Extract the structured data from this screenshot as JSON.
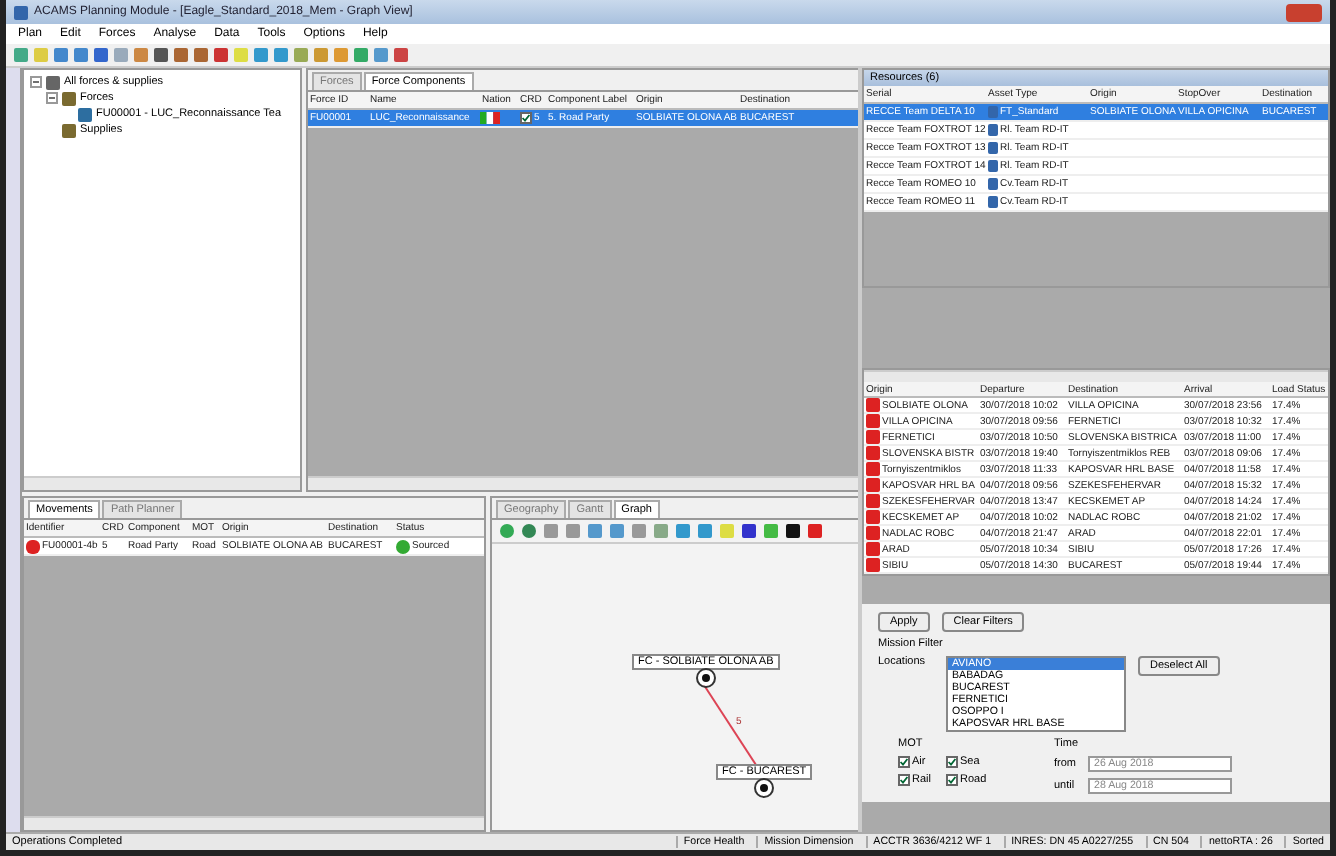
{
  "window": {
    "title": "ACAMS Planning Module - [Eagle_Standard_2018_Mem - Graph View]"
  },
  "menu": [
    "Plan",
    "Edit",
    "Forces",
    "Analyse",
    "Data",
    "Tools",
    "Options",
    "Help"
  ],
  "tree": {
    "label": "All forces & supplies",
    "expanded": true,
    "children": [
      {
        "label": "Forces",
        "expanded": true,
        "children": [
          {
            "label": "FU00001 - LUC_Reconnaissance Tea"
          }
        ]
      },
      {
        "label": "Supplies"
      }
    ]
  },
  "top_tabs": [
    {
      "label": "Forces",
      "selected": false
    },
    {
      "label": "Force Components",
      "selected": true
    }
  ],
  "force_table": {
    "columns": [
      "Force ID",
      "Name",
      "Nation",
      "CRD",
      "Component Label",
      "Origin",
      "Destination"
    ],
    "rows": [
      {
        "selected": true,
        "cells": [
          "FU00001",
          "LUC_Reconnaissance",
          "",
          "5",
          "5. Road Party",
          "SOLBIATE OLONA AB",
          "BUCAREST"
        ]
      }
    ]
  },
  "bottom_tabs": [
    {
      "label": "Movements",
      "selected": true
    },
    {
      "label": "Path Planner",
      "selected": false
    }
  ],
  "movements": {
    "columns": [
      "Identifier",
      "CRD",
      "Component",
      "MOT",
      "Origin",
      "Destination",
      "Status"
    ],
    "rows": [
      {
        "selected": false,
        "cells": [
          "FU00001-4b",
          "5",
          "Road Party",
          "Road",
          "SOLBIATE OLONA AB",
          "BUCAREST",
          "Sourced"
        ]
      }
    ]
  },
  "graph_tabs": [
    {
      "label": "Geography",
      "selected": false
    },
    {
      "label": "Gantt",
      "selected": false
    },
    {
      "label": "Graph",
      "selected": true
    }
  ],
  "graph": {
    "nodes": [
      "FC - SOLBIATE OLONA AB",
      "FC - BUCAREST"
    ],
    "edge_label": "5"
  },
  "resources": {
    "title": "Resources (6)",
    "columns": [
      "Serial",
      "Asset Type",
      "Origin",
      "StopOver",
      "Destination"
    ],
    "rows": [
      {
        "selected": true,
        "cells": [
          "RECCE Team DELTA 10",
          "FT_Standard",
          "SOLBIATE OLONA",
          "VILLA OPICINA",
          "BUCAREST"
        ]
      },
      {
        "selected": false,
        "cells": [
          "Recce Team FOXTROT 12",
          "Rl. Team RD-IT",
          "",
          "",
          ""
        ]
      },
      {
        "selected": false,
        "cells": [
          "Recce Team FOXTROT 13",
          "Rl. Team RD-IT",
          "",
          "",
          ""
        ]
      },
      {
        "selected": false,
        "cells": [
          "Recce Team FOXTROT 14",
          "Rl. Team RD-IT",
          "",
          "",
          ""
        ]
      },
      {
        "selected": false,
        "cells": [
          "Recce Team ROMEO 10",
          "Cv.Team RD-IT",
          "",
          "",
          ""
        ]
      },
      {
        "selected": false,
        "cells": [
          "Recce Team ROMEO 11",
          "Cv.Team RD-IT",
          "",
          "",
          ""
        ]
      }
    ]
  },
  "legs": {
    "columns": [
      "Origin",
      "Departure",
      "Destination",
      "Arrival",
      "Load Status"
    ],
    "rows": [
      [
        "SOLBIATE OLONA",
        "30/07/2018 10:02",
        "VILLA OPICINA",
        "30/07/2018 23:56",
        "17.4%"
      ],
      [
        "VILLA OPICINA",
        "30/07/2018 09:56",
        "FERNETICI",
        "03/07/2018 10:32",
        "17.4%"
      ],
      [
        "FERNETICI",
        "03/07/2018 10:50",
        "SLOVENSKA BISTRICA",
        "03/07/2018 11:00",
        "17.4%"
      ],
      [
        "SLOVENSKA BISTR",
        "03/07/2018 19:40",
        "Tornyiszentmiklos REB",
        "03/07/2018 09:06",
        "17.4%"
      ],
      [
        "Tornyiszentmiklos",
        "03/07/2018 11:33",
        "KAPOSVAR HRL BASE",
        "04/07/2018 11:58",
        "17.4%"
      ],
      [
        "KAPOSVAR HRL BA",
        "04/07/2018 09:56",
        "SZEKESFEHERVAR",
        "04/07/2018 15:32",
        "17.4%"
      ],
      [
        "SZEKESFEHERVAR",
        "04/07/2018 13:47",
        "KECSKEMET AP",
        "04/07/2018 14:24",
        "17.4%"
      ],
      [
        "KECSKEMET AP",
        "04/07/2018 10:02",
        "NADLAC ROBC",
        "04/07/2018 21:02",
        "17.4%"
      ],
      [
        "NADLAC ROBC",
        "04/07/2018 21:47",
        "ARAD",
        "04/07/2018 22:01",
        "17.4%"
      ],
      [
        "ARAD",
        "05/07/2018 10:34",
        "SIBIU",
        "05/07/2018 17:26",
        "17.4%"
      ],
      [
        "SIBIU",
        "05/07/2018 14:30",
        "BUCAREST",
        "05/07/2018 19:44",
        "17.4%"
      ]
    ]
  },
  "filters": {
    "apply": "Apply",
    "clear": "Clear Filters",
    "mission_filter": "Mission Filter",
    "locations_label": "Locations",
    "locations": [
      {
        "label": "AVIANO",
        "selected": true
      },
      {
        "label": "BABADAG",
        "selected": false
      },
      {
        "label": "BUCAREST",
        "selected": false
      },
      {
        "label": "FERNETICI",
        "selected": false
      },
      {
        "label": "OSOPPO I",
        "selected": false
      },
      {
        "label": "KAPOSVAR HRL BASE",
        "selected": false
      }
    ],
    "deselect_all": "Deselect All",
    "mot_label": "MOT",
    "mot": [
      {
        "label": "Air",
        "checked": true
      },
      {
        "label": "Sea",
        "checked": true
      },
      {
        "label": "Rail",
        "checked": true
      },
      {
        "label": "Road",
        "checked": true
      }
    ],
    "time_label": "Time",
    "from_label": "from",
    "from": "26 Aug 2018",
    "until_label": "until",
    "until": "28 Aug 2018"
  },
  "status_bar": {
    "left": "Operations Completed",
    "segments": [
      "Force Health",
      "Mission Dimension",
      "ACCTR 3636/4212 WF 1",
      "INRES: DN 45 A0227/255",
      "CN 504",
      "nettoRTA : 26",
      "Sorted"
    ]
  }
}
